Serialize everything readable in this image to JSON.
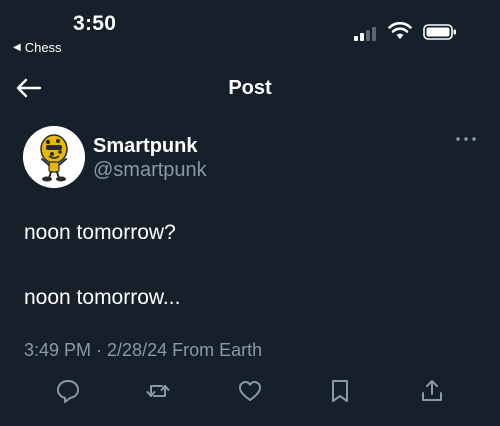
{
  "status_bar": {
    "time": "3:50",
    "back_app": "Chess",
    "icons": [
      "signal-icon",
      "wifi-icon",
      "battery-icon"
    ]
  },
  "header": {
    "title": "Post",
    "back_icon": "arrow-left-icon"
  },
  "post": {
    "author": {
      "display_name": "Smartpunk",
      "handle": "@smartpunk"
    },
    "more_icon": "more-horizontal-icon",
    "lines": [
      "noon tomorrow?",
      "noon tomorrow..."
    ],
    "meta": "3:49 PM · 2/28/24 From Earth"
  },
  "actions": [
    "reply-icon",
    "repost-icon",
    "like-icon",
    "bookmark-icon",
    "share-icon"
  ],
  "colors": {
    "background": "#15202b",
    "text": "#ffffff",
    "muted": "#8b98a5",
    "icon": "#8b98a5"
  }
}
